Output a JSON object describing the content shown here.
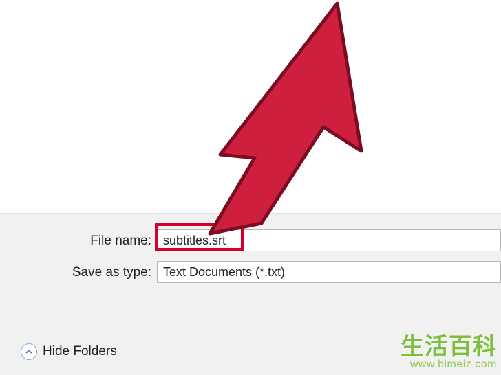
{
  "form": {
    "filename_label": "File name:",
    "filename_value": "subtitles.srt",
    "savetype_label": "Save as type:",
    "savetype_value": "Text Documents (*.txt)"
  },
  "footer": {
    "hide_folders_label": "Hide Folders"
  },
  "watermark": {
    "brand": "生活百科",
    "url": "www.bimeiz.com"
  },
  "annotation": {
    "arrow_color": "#cf1f3f",
    "arrow_stroke": "#7a0d22",
    "highlight_target": "filename-input"
  }
}
